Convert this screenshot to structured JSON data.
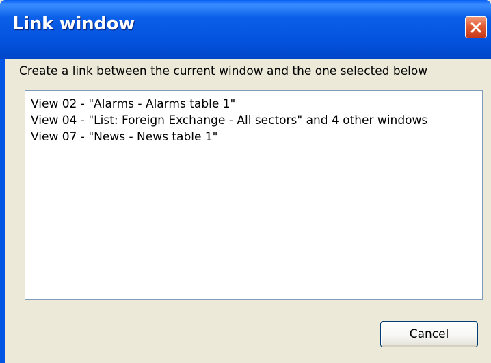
{
  "window": {
    "title": "Link window",
    "close_icon": "close-icon"
  },
  "dialog": {
    "description": "Create a link between the current window and the one selected below",
    "items": [
      {
        "label": "View 02 - \"Alarms - Alarms table 1\""
      },
      {
        "label": "View 04 - \"List: Foreign Exchange - All sectors\" and 4 other windows"
      },
      {
        "label": "View 07 - \"News - News table 1\""
      }
    ],
    "cancel_label": "Cancel"
  },
  "colors": {
    "titlebar": "#0452DE",
    "client_background": "#ECE9D8",
    "close_button": "#E25A32",
    "listbox_border": "#7F9DB9",
    "button_border": "#003C74"
  }
}
